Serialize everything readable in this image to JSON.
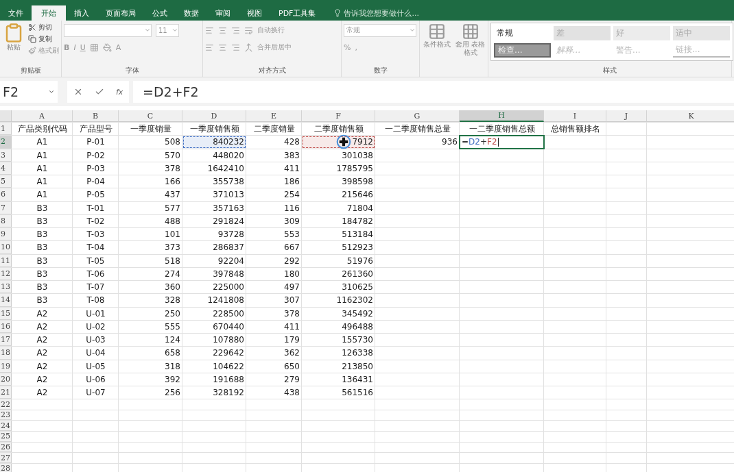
{
  "tabs": [
    {
      "label": "文件",
      "selected": false
    },
    {
      "label": "开始",
      "selected": true
    },
    {
      "label": "插入",
      "selected": false
    },
    {
      "label": "页面布局",
      "selected": false
    },
    {
      "label": "公式",
      "selected": false
    },
    {
      "label": "数据",
      "selected": false
    },
    {
      "label": "审阅",
      "selected": false
    },
    {
      "label": "视图",
      "selected": false
    },
    {
      "label": "PDF工具集",
      "selected": false
    }
  ],
  "tell_me": {
    "placeholder": "告诉我您想要做什么..."
  },
  "clipboard": {
    "paste": "粘贴",
    "cut": "剪切",
    "copy": "复制",
    "format_painter": "格式刷",
    "label": "剪贴板"
  },
  "font": {
    "size": "11",
    "bold": "B",
    "italic": "I",
    "underline": "U",
    "font_color": "A",
    "label": "字体"
  },
  "alignment": {
    "wrap": "自动换行",
    "merge": "合并后居中",
    "label": "对齐方式"
  },
  "number": {
    "format": "常规",
    "percent": "%",
    "comma": ",",
    "label": "数字"
  },
  "styles": {
    "conditional": "条件格式",
    "table_top": "套用",
    "table_bottom": "表格格式",
    "gallery": [
      {
        "text": "常规",
        "kind": "normal"
      },
      {
        "text": "差",
        "kind": "bad"
      },
      {
        "text": "好",
        "kind": "good"
      },
      {
        "text": "适中",
        "kind": "neutral"
      },
      {
        "text": "检查...",
        "kind": "check"
      },
      {
        "text": "解释...",
        "kind": "explain"
      },
      {
        "text": "警告...",
        "kind": "warning"
      },
      {
        "text": "链接...",
        "kind": "link"
      }
    ],
    "label": "样式"
  },
  "name_box": "F2",
  "fx_label": "fx",
  "formula": "=D2+F2",
  "columns": [
    {
      "letter": "A",
      "selected": false
    },
    {
      "letter": "B",
      "selected": false
    },
    {
      "letter": "C",
      "selected": false
    },
    {
      "letter": "D",
      "selected": false
    },
    {
      "letter": "E",
      "selected": false
    },
    {
      "letter": "F",
      "selected": false
    },
    {
      "letter": "G",
      "selected": false
    },
    {
      "letter": "H",
      "selected": true
    },
    {
      "letter": "I",
      "selected": false
    },
    {
      "letter": "J",
      "selected": false
    },
    {
      "letter": "K",
      "selected": false
    }
  ],
  "rows": [
    {
      "header": "1",
      "selected": false,
      "cells": [
        "产品类别代码",
        "产品型号",
        "一季度销量",
        "一季度销售额",
        "二季度销量",
        "二季度销售额",
        "一二季度销售总量",
        "一二季度销售总额",
        "总销售额排名"
      ]
    },
    {
      "header": "2",
      "selected": true,
      "cells": [
        "A1",
        "P-01",
        "508",
        {
          "text": "840232",
          "color": "#4472c4"
        },
        "428",
        {
          "text": "7912",
          "color": "#c0504d",
          "cursor": true
        },
        "936",
        {
          "kind": "editing",
          "parts": [
            {
              "text": "=",
              "color": "#333333"
            },
            {
              "text": "D2",
              "color": "#4472c4"
            },
            {
              "text": "+",
              "color": "#333333"
            },
            {
              "text": "F2",
              "color": "#c0504d"
            }
          ]
        }
      ]
    },
    {
      "header": "3",
      "selected": false,
      "cells": [
        "A1",
        "P-02",
        "570",
        "448020",
        "383",
        "301038"
      ]
    },
    {
      "header": "4",
      "selected": false,
      "cells": [
        "A1",
        "P-03",
        "378",
        "1642410",
        "411",
        "1785795"
      ]
    },
    {
      "header": "5",
      "selected": false,
      "cells": [
        "A1",
        "P-04",
        "166",
        "355738",
        "186",
        "398598"
      ]
    },
    {
      "header": "6",
      "selected": false,
      "cells": [
        "A1",
        "P-05",
        "437",
        "371013",
        "254",
        "215646"
      ]
    },
    {
      "header": "7",
      "selected": false,
      "cells": [
        "B3",
        "T-01",
        "577",
        "357163",
        "116",
        "71804"
      ]
    },
    {
      "header": "8",
      "selected": false,
      "cells": [
        "B3",
        "T-02",
        "488",
        "291824",
        "309",
        "184782"
      ]
    },
    {
      "header": "9",
      "selected": false,
      "cells": [
        "B3",
        "T-03",
        "101",
        "93728",
        "553",
        "513184"
      ]
    },
    {
      "header": "10",
      "selected": false,
      "cells": [
        "B3",
        "T-04",
        "373",
        "286837",
        "667",
        "512923"
      ]
    },
    {
      "header": "11",
      "selected": false,
      "cells": [
        "B3",
        "T-05",
        "518",
        "92204",
        "292",
        "51976"
      ]
    },
    {
      "header": "12",
      "selected": false,
      "cells": [
        "B3",
        "T-06",
        "274",
        "397848",
        "180",
        "261360"
      ]
    },
    {
      "header": "13",
      "selected": false,
      "cells": [
        "B3",
        "T-07",
        "360",
        "225000",
        "497",
        "310625"
      ]
    },
    {
      "header": "14",
      "selected": false,
      "cells": [
        "B3",
        "T-08",
        "328",
        "1241808",
        "307",
        "1162302"
      ]
    },
    {
      "header": "15",
      "selected": false,
      "cells": [
        "A2",
        "U-01",
        "250",
        "228500",
        "378",
        "345492"
      ]
    },
    {
      "header": "16",
      "selected": false,
      "cells": [
        "A2",
        "U-02",
        "555",
        "670440",
        "411",
        "496488"
      ]
    },
    {
      "header": "17",
      "selected": false,
      "cells": [
        "A2",
        "U-03",
        "124",
        "107880",
        "179",
        "155730"
      ]
    },
    {
      "header": "18",
      "selected": false,
      "cells": [
        "A2",
        "U-04",
        "658",
        "229642",
        "362",
        "126338"
      ]
    },
    {
      "header": "19",
      "selected": false,
      "cells": [
        "A2",
        "U-05",
        "318",
        "104622",
        "650",
        "213850"
      ]
    },
    {
      "header": "20",
      "selected": false,
      "cells": [
        "A2",
        "U-06",
        "392",
        "191688",
        "279",
        "136431"
      ]
    },
    {
      "header": "21",
      "selected": false,
      "cells": [
        "A2",
        "U-07",
        "256",
        "328192",
        "438",
        "561516"
      ]
    },
    {
      "header": "22",
      "selected": false,
      "cells": []
    },
    {
      "header": "23",
      "selected": false,
      "cells": []
    },
    {
      "header": "24",
      "selected": false,
      "cells": []
    },
    {
      "header": "25",
      "selected": false,
      "cells": []
    },
    {
      "header": "26",
      "selected": false,
      "cells": []
    },
    {
      "header": "27",
      "selected": false,
      "cells": []
    },
    {
      "header": "28",
      "selected": false,
      "cells": []
    }
  ]
}
